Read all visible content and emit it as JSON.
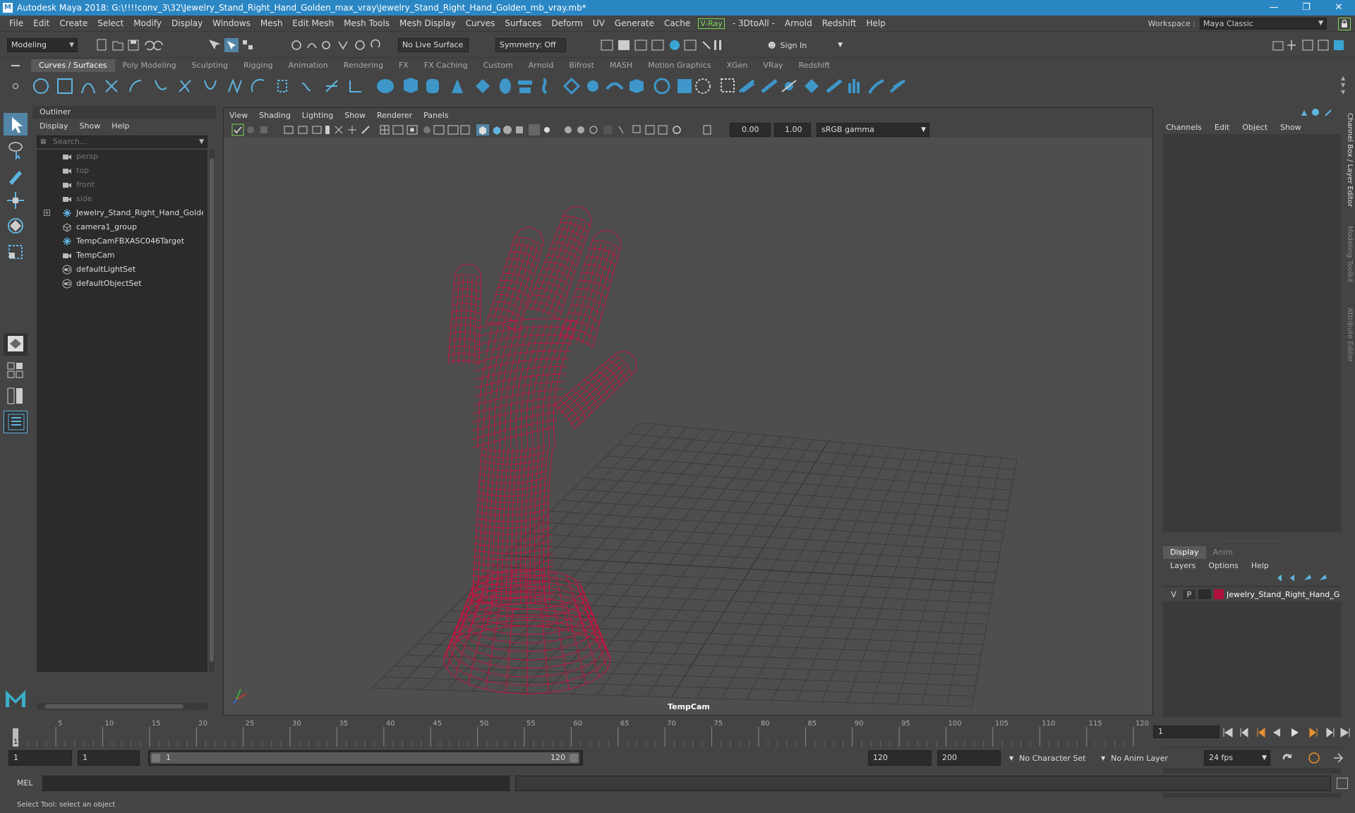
{
  "window": {
    "title": "Autodesk Maya 2018: G:\\!!!!conv_3\\32\\Jewelry_Stand_Right_Hand_Golden_max_vray\\Jewelry_Stand_Right_Hand_Golden_mb_vray.mb*",
    "logo": "M"
  },
  "menubar": {
    "items": [
      "File",
      "Edit",
      "Create",
      "Select",
      "Modify",
      "Display",
      "Windows",
      "Mesh",
      "Edit Mesh",
      "Mesh Tools",
      "Mesh Display",
      "Curves",
      "Surfaces",
      "Deform",
      "UV",
      "Generate",
      "Cache"
    ],
    "vray": "V-Ray",
    "items2": [
      "- 3DtoAll -",
      "Arnold",
      "Redshift",
      "Help"
    ]
  },
  "workspace": {
    "label": "Workspace :",
    "value": "Maya Classic"
  },
  "statusline": {
    "mode": "Modeling",
    "live_surface": "No Live Surface",
    "symmetry": "Symmetry: Off",
    "sign_in": "Sign In"
  },
  "shelf": {
    "tabs": [
      "Curves / Surfaces",
      "Poly Modeling",
      "Sculpting",
      "Rigging",
      "Animation",
      "Rendering",
      "FX",
      "FX Caching",
      "Custom",
      "Arnold",
      "Bifrost",
      "MASH",
      "Motion Graphics",
      "XGen",
      "VRay",
      "Redshift"
    ],
    "active_tab": 0
  },
  "outliner": {
    "title": "Outliner",
    "menu": [
      "Display",
      "Show",
      "Help"
    ],
    "search_placeholder": "Search...",
    "items": [
      {
        "label": "persp",
        "icon": "camera-icon",
        "dim": true
      },
      {
        "label": "top",
        "icon": "camera-icon",
        "dim": true
      },
      {
        "label": "front",
        "icon": "camera-icon",
        "dim": true
      },
      {
        "label": "side",
        "icon": "camera-icon",
        "dim": true
      },
      {
        "label": "Jewelry_Stand_Right_Hand_Golden_r",
        "icon": "transform-icon",
        "dim": false,
        "expandable": true
      },
      {
        "label": "camera1_group",
        "icon": "group-icon",
        "dim": false
      },
      {
        "label": "TempCamFBXASC046Target",
        "icon": "transform-icon",
        "dim": false
      },
      {
        "label": "TempCam",
        "icon": "camera-icon",
        "dim": false
      },
      {
        "label": "defaultLightSet",
        "icon": "set-icon",
        "dim": false
      },
      {
        "label": "defaultObjectSet",
        "icon": "set-icon",
        "dim": false
      }
    ]
  },
  "viewport": {
    "menu": [
      "View",
      "Shading",
      "Lighting",
      "Show",
      "Renderer",
      "Panels"
    ],
    "exposure": "0.00",
    "gamma": "1.00",
    "color_space": "sRGB gamma",
    "camera_label": "TempCam",
    "wire_color": "#c8103e"
  },
  "channelbox": {
    "menu": [
      "Channels",
      "Edit",
      "Object",
      "Show"
    ],
    "side_tabs": [
      "Channel Box / Layer Editor",
      "Modeling Toolkit",
      "Attribute Editor"
    ],
    "layer_tabs": [
      "Display",
      "Anim"
    ],
    "layer_menu": [
      "Layers",
      "Options",
      "Help"
    ],
    "layer": {
      "v": "V",
      "p": "P",
      "name": "Jewelry_Stand_Right_Hand_Go",
      "color": "#b0103a"
    }
  },
  "timeline": {
    "ticks": [
      "5",
      "10",
      "15",
      "20",
      "25",
      "30",
      "35",
      "40",
      "45",
      "50",
      "55",
      "60",
      "65",
      "70",
      "75",
      "80",
      "85",
      "90",
      "95",
      "100",
      "105",
      "110",
      "115",
      "120"
    ],
    "start_mark": "1",
    "current_frame": "1"
  },
  "range": {
    "start": "1",
    "playback_start": "1",
    "slider_start": "1",
    "slider_end": "120",
    "playback_end": "120",
    "end": "200",
    "character_set": "No Character Set",
    "anim_layer": "No Anim Layer",
    "fps": "24 fps"
  },
  "cmdline": {
    "label": "MEL"
  },
  "helpline": {
    "text": "Select Tool: select an object"
  }
}
